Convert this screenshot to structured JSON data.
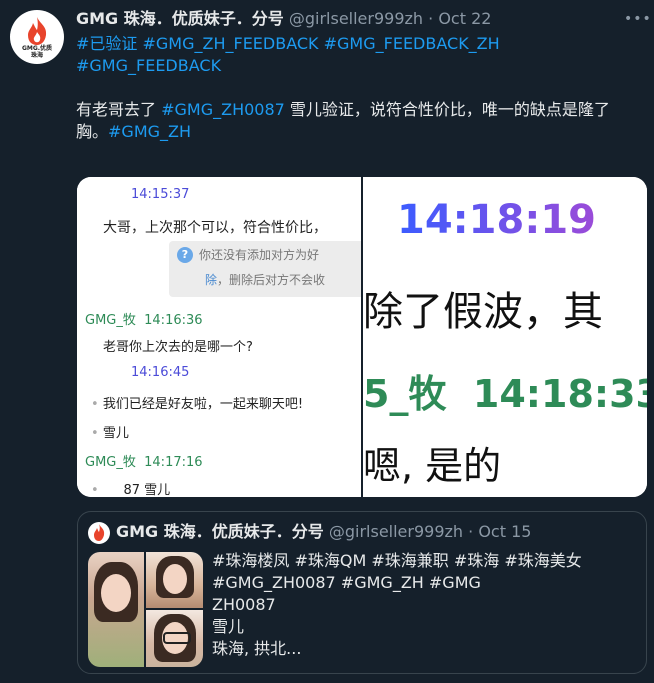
{
  "tweet": {
    "avatar_text": "GMG.优质\n珠海",
    "author_name": "GMG 珠海．优质妹子．分号",
    "handle": "@girlseller999zh",
    "separator": " · ",
    "date": "Oct 22",
    "more_icon": "more-dots-icon",
    "hashtags_line1": "#已验证 #GMG_ZH_FEEDBACK #GMG_FEEDBACK_ZH",
    "hashtags_line2": "#GMG_FEEDBACK",
    "msg_part1": "有老哥去了",
    "msg_tag1": "#GMG_ZH0087",
    "msg_part2": "雪儿验证，说符合性价比，唯一的缺点是隆了",
    "msg_part3": "胸。",
    "msg_tag2": "#GMG_ZH"
  },
  "media": {
    "left": {
      "time1": "14:15:37",
      "line1": "大哥，上次那个可以，符合性价比，",
      "notice_line1": "你还没有添加对方为好",
      "notice_link": "除",
      "notice_line2": "，删除后对方不会收",
      "sender1": "GMG_牧",
      "time2": "14:16:36",
      "line2": "老哥你上次去的是哪一个?",
      "time3": "14:16:45",
      "line3": "我们已经是好友啦，一起来聊天吧!",
      "line4": "雪儿",
      "sender2": "GMG_牧",
      "time4": "14:17:16",
      "line5": "87 雪儿"
    },
    "right": {
      "time1": "14:18:19",
      "text1": "除了假波，其",
      "sender": "5_牧",
      "time2": "14:18:33",
      "text2": "嗯, 是的"
    }
  },
  "quote": {
    "author_name": "GMG 珠海．优质妹子．分号",
    "handle": "@girlseller999zh",
    "separator": " · ",
    "date": "Oct 15",
    "line1": "#珠海楼凤 #珠海QM #珠海兼职 #珠海 #珠海美女",
    "line2": "#GMG_ZH0087 #GMG_ZH #GMG",
    "line3": "ZH0087",
    "line4": "雪儿",
    "line5": "珠海, 拱北..."
  },
  "colors": {
    "background": "#15202b",
    "link": "#1d9bf0",
    "muted": "#8b98a5",
    "text": "#e7e9ea",
    "avatar_brand": "#e8442c"
  }
}
